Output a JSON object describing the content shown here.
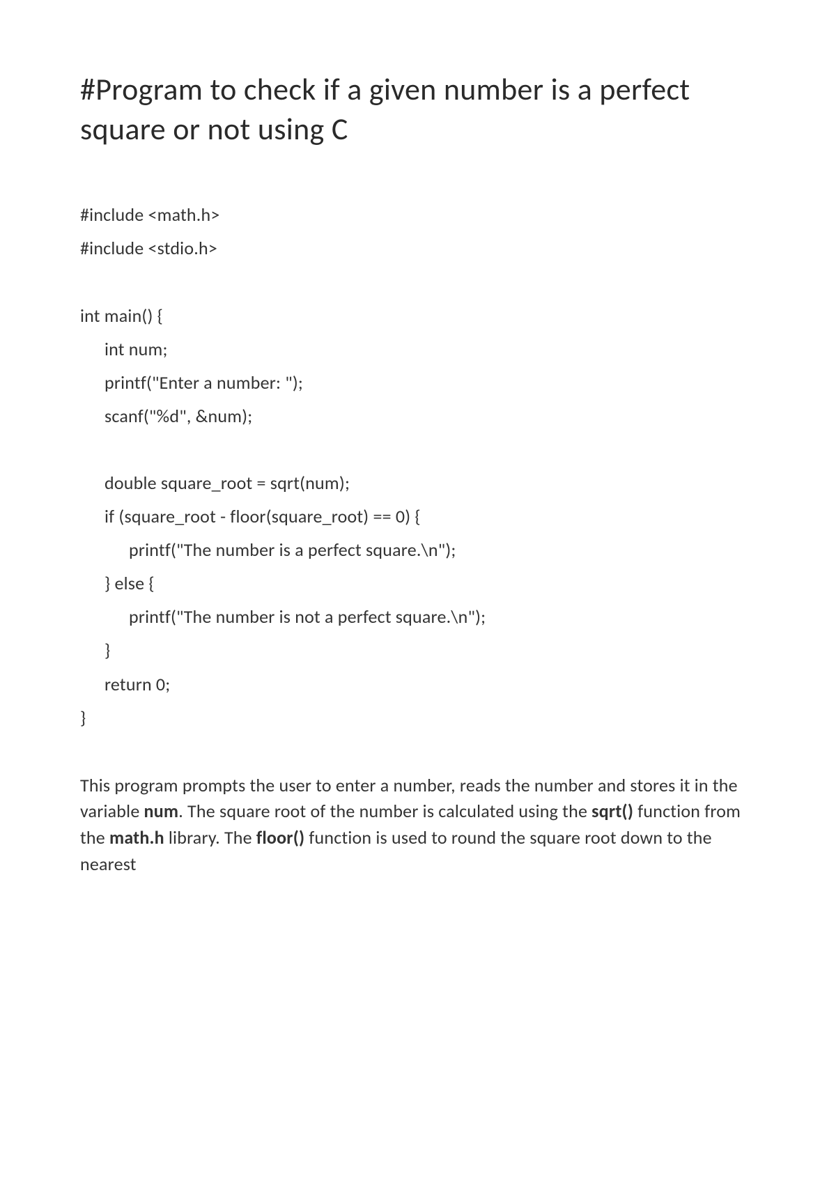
{
  "title": "#Program to check if a given number is a perfect square or not using C",
  "code": {
    "line1": "#include <math.h>",
    "line2": "#include <stdio.h>",
    "line3": "int main() {",
    "line4": "int num;",
    "line5": "printf(\"Enter a number: \");",
    "line6": "scanf(\"%d\", &num);",
    "line7": "double square_root = sqrt(num);",
    "line8": "if (square_root - floor(square_root) == 0) {",
    "line9": "printf(\"The number is a perfect square.\\n\");",
    "line10": "} else {",
    "line11": "printf(\"The number is not a perfect square.\\n\");",
    "line12": "}",
    "line13": "return 0;",
    "line14": "}"
  },
  "description": {
    "part1": "This program prompts the user to enter a number, reads the number and stores it in the variable ",
    "bold1": "num",
    "part2": ". The square root of the number is calculated using the ",
    "bold2": "sqrt()",
    "part3": " function from the ",
    "bold3": "math.h",
    "part4": " library. The ",
    "bold4": "floor()",
    "part5": " function is used to round the square root down to the nearest"
  }
}
